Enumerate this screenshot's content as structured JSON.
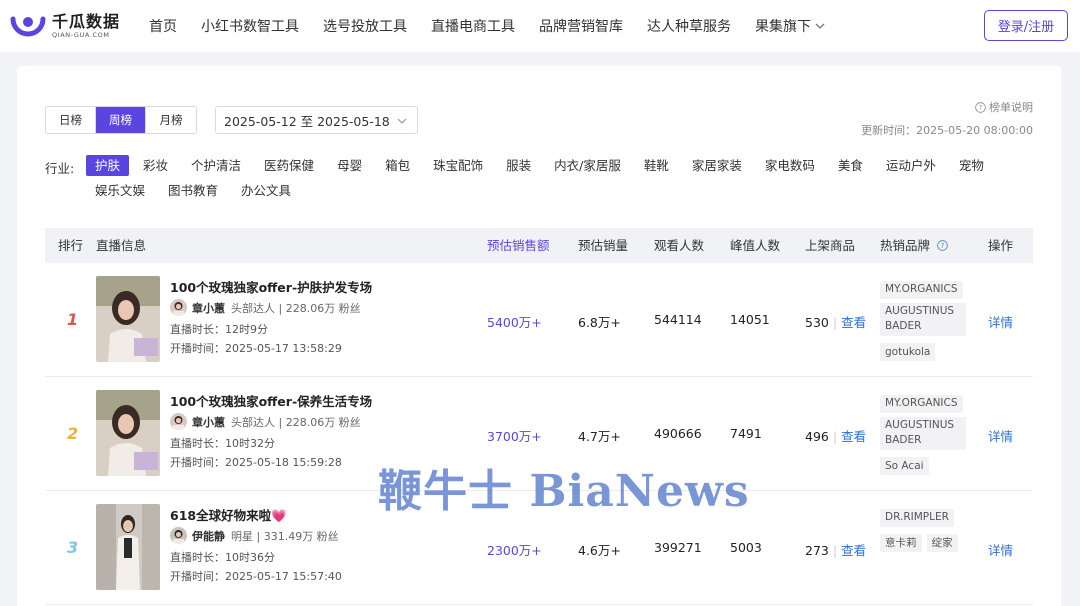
{
  "brand": {
    "name": "千瓜数据",
    "sub": "QIAN-GUA.COM"
  },
  "nav": {
    "items": [
      "首页",
      "小红书数智工具",
      "选号投放工具",
      "直播电商工具",
      "品牌营销智库",
      "达人种草服务",
      "果集旗下"
    ],
    "login": "登录/注册"
  },
  "filters": {
    "periods": [
      "日榜",
      "周榜",
      "月榜"
    ],
    "active_period": "周榜",
    "date_range": "2025-05-12 至 2025-05-18",
    "explain": "榜单说明",
    "update_time": "更新时间：2025-05-20 08:00:00"
  },
  "industry": {
    "label": "行业:",
    "active": "护肤",
    "categories": [
      "护肤",
      "彩妆",
      "个护清洁",
      "医药保健",
      "母婴",
      "箱包",
      "珠宝配饰",
      "服装",
      "内衣/家居服",
      "鞋靴",
      "家居家装",
      "家电数码",
      "美食",
      "运动户外",
      "宠物",
      "娱乐文娱",
      "图书教育",
      "办公文具"
    ]
  },
  "table": {
    "headers": [
      "排行",
      "直播信息",
      "预估销售额",
      "预估销量",
      "观看人数",
      "峰值人数",
      "上架商品",
      "热销品牌",
      "操作"
    ],
    "view_label": "查看",
    "detail_label": "详情",
    "rows": [
      {
        "rank": "1",
        "title": "100个玫瑰独家offer-护肤护发专场",
        "anchor": "章小蕙",
        "anchor_meta": "头部达人 | 228.06万 粉丝",
        "duration": "直播时长：12时9分",
        "start": "开播时间：2025-05-17 13:58:29",
        "sales": "5400万+",
        "volume": "6.8万+",
        "viewers": "544114",
        "peak": "14051",
        "products": "530",
        "brands": [
          "MY.ORGANICS",
          "AUGUSTINUS BADER",
          "gotukola"
        ]
      },
      {
        "rank": "2",
        "title": "100个玫瑰独家offer-保养生活专场",
        "anchor": "章小蕙",
        "anchor_meta": "头部达人 | 228.06万 粉丝",
        "duration": "直播时长：10时32分",
        "start": "开播时间：2025-05-18 15:59:28",
        "sales": "3700万+",
        "volume": "4.7万+",
        "viewers": "490666",
        "peak": "7491",
        "products": "496",
        "brands": [
          "MY.ORGANICS",
          "AUGUSTINUS BADER",
          "So Acai"
        ]
      },
      {
        "rank": "3",
        "title": "618全球好物来啦💗",
        "anchor": "伊能静",
        "anchor_meta": "明星 | 331.49万 粉丝",
        "duration": "直播时长：10时36分",
        "start": "开播时间：2025-05-17 15:57:40",
        "sales": "2300万+",
        "volume": "4.6万+",
        "viewers": "399271",
        "peak": "5003",
        "products": "273",
        "brands": [
          "DR.RIMPLER",
          "意卡莉",
          "绽家"
        ]
      }
    ]
  },
  "watermark": "鞭牛士 BiaNews",
  "colors": {
    "accent": "#5b45e0",
    "link": "#2f6fd6",
    "rank1": "#e0544d",
    "rank2": "#f0b030",
    "rank3": "#7cc7e8"
  }
}
